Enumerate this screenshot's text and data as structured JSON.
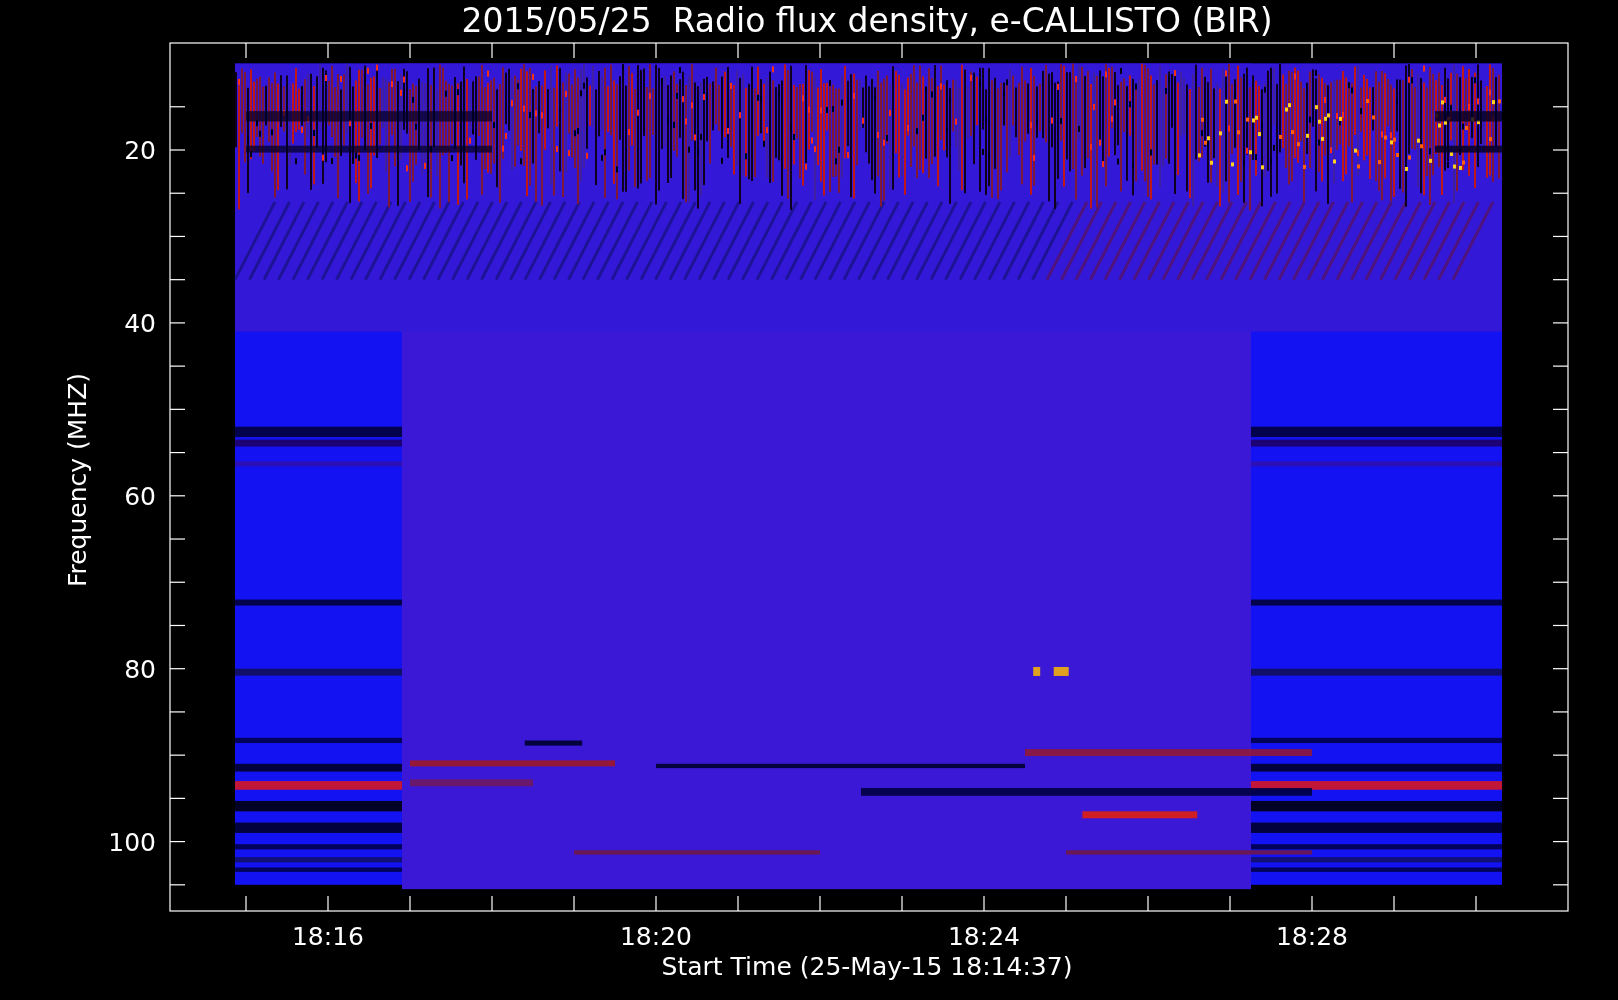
{
  "title": "2015/05/25  Radio flux density, e-CALLISTO (BIR)",
  "x_axis": {
    "label": "Start Time (25-May-15 18:14:37)",
    "ticks": [
      "18:16",
      "18:20",
      "18:24",
      "18:28"
    ]
  },
  "y_axis": {
    "label": "Frequency (MHZ)",
    "ticks": [
      "20",
      "40",
      "60",
      "80",
      "100"
    ]
  }
}
